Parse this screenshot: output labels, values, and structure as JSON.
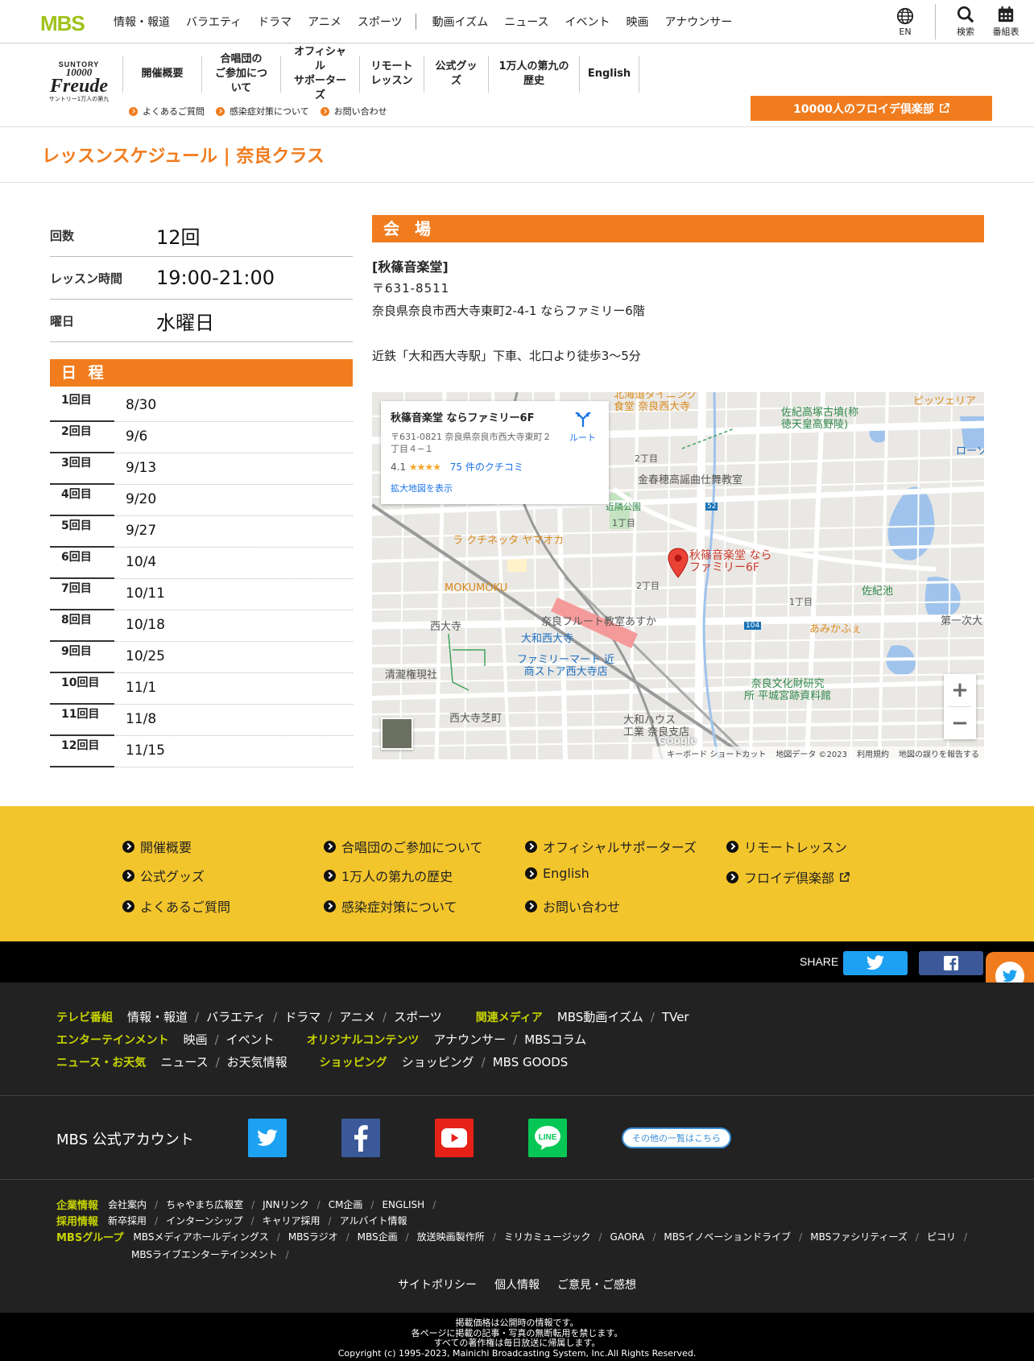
{
  "mbs": {
    "logo": "MBS",
    "nav_group1": [
      "情報・報道",
      "バラエティ",
      "ドラマ",
      "アニメ",
      "スポーツ"
    ],
    "nav_group2": [
      "動画イズム",
      "ニュース",
      "イベント",
      "映画",
      "アナウンサー"
    ],
    "utils": {
      "lang": "EN",
      "search": "検索",
      "schedule": "番組表"
    }
  },
  "freude": {
    "logo": {
      "line1": "SUNTORY",
      "line2": "10000",
      "line3": "Freude",
      "line4": "サントリー1万人の第九"
    },
    "nav": [
      "開催概要",
      "合唱団の\nご参加について",
      "オフィシャル\nサポーターズ",
      "リモート\nレッスン",
      "公式グッズ",
      "1万人の第九の\n歴史",
      "English"
    ],
    "sub_nav": [
      "よくあるご質問",
      "感染症対策について",
      "お問い合わせ"
    ],
    "club_button": "10000人のフロイデ倶楽部"
  },
  "page_title": "レッスンスケジュール | 奈良クラス",
  "info": [
    {
      "label": "回数",
      "value": "12回"
    },
    {
      "label": "レッスン時間",
      "value": "19:00-21:00"
    },
    {
      "label": "曜日",
      "value": "水曜日"
    }
  ],
  "schedule": {
    "heading": "日 程",
    "rows": [
      {
        "n": "1回目",
        "date": "8/30"
      },
      {
        "n": "2回目",
        "date": "9/6"
      },
      {
        "n": "3回目",
        "date": "9/13"
      },
      {
        "n": "4回目",
        "date": "9/20"
      },
      {
        "n": "5回目",
        "date": "9/27"
      },
      {
        "n": "6回目",
        "date": "10/4"
      },
      {
        "n": "7回目",
        "date": "10/11"
      },
      {
        "n": "8回目",
        "date": "10/18"
      },
      {
        "n": "9回目",
        "date": "10/25"
      },
      {
        "n": "10回目",
        "date": "11/1"
      },
      {
        "n": "11回目",
        "date": "11/8"
      },
      {
        "n": "12回目",
        "date": "11/15"
      }
    ]
  },
  "venue": {
    "heading": "会 場",
    "name": "[秋篠音楽堂]",
    "postal": "〒631-8511",
    "address": "奈良県奈良市西大寺東町2-4-1 ならファミリー6階",
    "access": "近鉄「大和西大寺駅」下車、北口より徒歩3～5分"
  },
  "map": {
    "card_title": "秋篠音楽堂 ならファミリー6F",
    "card_address": "〒631-0821 奈良県奈良市西大寺東町２丁目４−１",
    "rating": "4.1",
    "stars": "★★★★",
    "reviews": "75 件のクチコミ",
    "enlarge": "拡大地図を表示",
    "route": "ルート",
    "pin_label": "秋篠音楽堂 なら\nファミリー6F",
    "labels": {
      "kinshun": "金春穂高謡曲仕舞教室",
      "rakuchi": "ラ クチネッタ ヤマオカ",
      "mokumoku": "MOKUMOKU",
      "saidaiji": "西大寺",
      "flute": "奈良フルート教室あすか",
      "station": "大和西大寺",
      "family": "ファミリーマート 近\n商ストア西大寺店",
      "seiryu": "清瀧権現社",
      "shiba": "西大寺芝町",
      "house": "大和ハウス\n工業 奈良支店",
      "bunka": "奈良文化財研究\n所 平城宮跡資料館",
      "amikafe": "あみかふぇ",
      "sakiike": "佐紀池",
      "kofun": "佐紀高塚古墳(称\n徳天皇高野陵)",
      "pizza": "ピッツェリア",
      "hokkaido": "北海道ダイニング\n食堂 奈良西大寺",
      "daiichi": "第一次大",
      "lawson": "ローソ",
      "park": "近隣公園",
      "chome2a": "2丁目",
      "chome1a": "1丁目",
      "chome2b": "2丁目",
      "chome1b": "1丁目",
      "r52": "52",
      "r104": "104"
    },
    "footer": [
      "キーボード ショートカット",
      "地図データ ©2023",
      "利用規約",
      "地図の誤りを報告する"
    ],
    "google": "Google"
  },
  "footer_nav": [
    [
      "開催概要",
      "合唱団のご参加について",
      "オフィシャルサポーターズ",
      "リモートレッスン"
    ],
    [
      "公式グッズ",
      "1万人の第九の歴史",
      "English",
      "フロイデ倶楽部"
    ],
    [
      "よくあるご質問",
      "感染症対策について",
      "お問い合わせ"
    ]
  ],
  "share": {
    "label": "SHARE"
  },
  "links": {
    "row1": {
      "cat1": "テレビ番組",
      "items1": [
        "情報・報道",
        "バラエティ",
        "ドラマ",
        "アニメ",
        "スポーツ"
      ],
      "cat2": "関連メディア",
      "items2": [
        "MBS動画イズム",
        "TVer"
      ]
    },
    "row2": {
      "cat1": "エンターテインメント",
      "items1": [
        "映画",
        "イベント"
      ],
      "cat2": "オリジナルコンテンツ",
      "items2": [
        "アナウンサー",
        "MBSコラム"
      ]
    },
    "row3": {
      "cat1": "ニュース・お天気",
      "items1": [
        "ニュース",
        "お天気情報"
      ],
      "cat2": "ショッピング",
      "items2": [
        "ショッピング",
        "MBS GOODS"
      ]
    }
  },
  "accounts": {
    "title": "MBS 公式アカウント",
    "more": "その他の一覧はこちら"
  },
  "corporate": {
    "cat1": "企業情報",
    "items1": [
      "会社案内",
      "ちゃやまち広報室",
      "JNNリンク",
      "CM企画",
      "ENGLISH"
    ],
    "cat2": "採用情報",
    "items2": [
      "新卒採用",
      "インターンシップ",
      "キャリア採用",
      "アルバイト情報"
    ],
    "cat3": "MBSグループ",
    "items3": [
      "MBSメディアホールディングス",
      "MBSラジオ",
      "MBS企画",
      "放送映画製作所",
      "ミリカミュージック",
      "GAORA",
      "MBSイノベーションドライブ",
      "MBSファシリティーズ",
      "ピコリ",
      "MBSライブエンターテインメント"
    ]
  },
  "policy": [
    "サイトポリシー",
    "個人情報",
    "ご意見・ご感想"
  ],
  "bottom": [
    "掲載価格は公開時の情報です。",
    "各ページに掲載の記事・写真の無断転用を禁じます。",
    "すべての著作権は毎日放送に帰属します。",
    "Copyright (c) 1995-2023, Mainichi Broadcasting System, Inc.All Rights Reserved."
  ],
  "colors": {
    "orange": "#f07c1e",
    "mbs_green": "#9fc219",
    "footer_yellow": "#f3c52c",
    "category_yellow": "#c8d400",
    "twitter": "#1da1f2",
    "facebook": "#3b5998",
    "youtube": "#e62117",
    "line": "#06c755"
  }
}
